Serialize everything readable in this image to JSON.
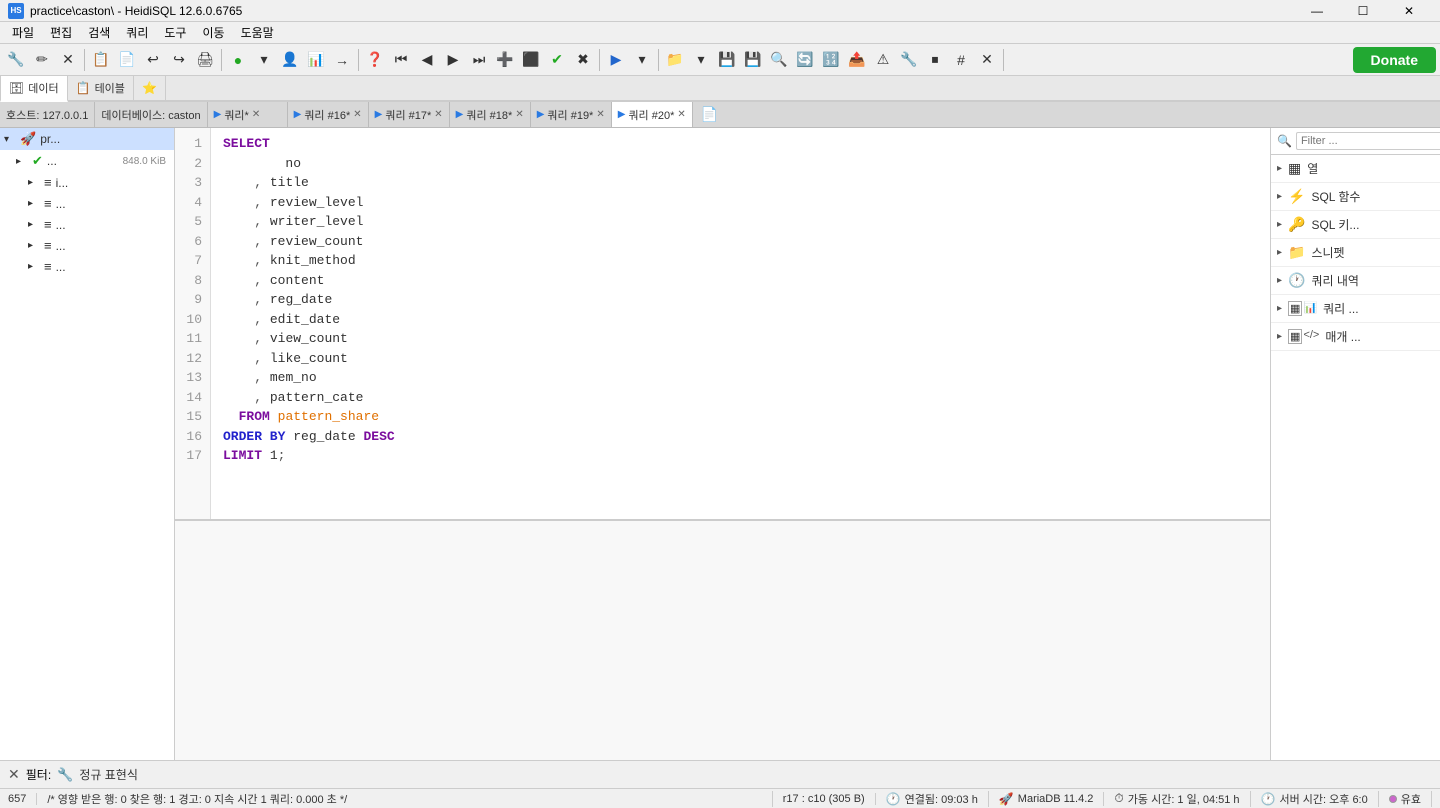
{
  "titlebar": {
    "icon": "HS",
    "title": "practice\\caston\\ - HeidiSQL 12.6.0.6765",
    "min": "—",
    "max": "☐",
    "close": "✕"
  },
  "menubar": {
    "items": [
      "파일",
      "편집",
      "검색",
      "쿼리",
      "도구",
      "이동",
      "도움말"
    ]
  },
  "toolbar": {
    "donate": "Donate"
  },
  "tabnav": {
    "items": [
      {
        "icon": "🗄",
        "label": "데이터",
        "active": true,
        "closable": false
      },
      {
        "icon": "📋",
        "label": "테이블",
        "active": false,
        "closable": false
      },
      {
        "icon": "⭐",
        "label": "",
        "active": false,
        "closable": false
      }
    ]
  },
  "querytabs": {
    "items": [
      {
        "label": "호스트: 127.0.0.1",
        "active": false,
        "closable": false,
        "hasPlay": false
      },
      {
        "label": "데이터베이스: caston",
        "active": false,
        "closable": false,
        "hasPlay": false
      },
      {
        "label": "쿼리*",
        "active": false,
        "closable": true,
        "hasPlay": false
      },
      {
        "label": "쿼리 #16*",
        "active": false,
        "closable": true,
        "hasPlay": false
      },
      {
        "label": "쿼리 #17*",
        "active": false,
        "closable": true,
        "hasPlay": false
      },
      {
        "label": "쿼리 #18*",
        "active": false,
        "closable": true,
        "hasPlay": false
      },
      {
        "label": "쿼리 #19*",
        "active": false,
        "closable": true,
        "hasPlay": false
      },
      {
        "label": "쿼리 #20*",
        "active": true,
        "closable": true,
        "hasPlay": true
      }
    ]
  },
  "sidebar": {
    "items": [
      {
        "level": 0,
        "arrow": "▾",
        "icon": "🚀",
        "label": "pr...",
        "badge": "",
        "selected": true
      },
      {
        "level": 0,
        "arrow": "▸",
        "icon": "✔",
        "label": "...",
        "badge": "848.0 KiB",
        "selected": false
      },
      {
        "level": 1,
        "arrow": "▸",
        "icon": "═",
        "label": "i...",
        "badge": "",
        "selected": false
      },
      {
        "level": 1,
        "arrow": "▸",
        "icon": "═",
        "label": "...",
        "badge": "",
        "selected": false
      },
      {
        "level": 1,
        "arrow": "▸",
        "icon": "═",
        "label": "...",
        "badge": "",
        "selected": false
      },
      {
        "level": 1,
        "arrow": "▸",
        "icon": "═",
        "label": "...",
        "badge": "",
        "selected": false
      },
      {
        "level": 1,
        "arrow": "▸",
        "icon": "═",
        "label": "...",
        "badge": "",
        "selected": false
      }
    ]
  },
  "editor": {
    "lines": [
      {
        "num": 1,
        "code": "SELECT"
      },
      {
        "num": 2,
        "code": "      no"
      },
      {
        "num": 3,
        "code": "    , title"
      },
      {
        "num": 4,
        "code": "    , review_level"
      },
      {
        "num": 5,
        "code": "    , writer_level"
      },
      {
        "num": 6,
        "code": "    , review_count"
      },
      {
        "num": 7,
        "code": "    , knit_method"
      },
      {
        "num": 8,
        "code": "    , content"
      },
      {
        "num": 9,
        "code": "    , reg_date"
      },
      {
        "num": 10,
        "code": "    , edit_date"
      },
      {
        "num": 11,
        "code": "    , view_count"
      },
      {
        "num": 12,
        "code": "    , like_count"
      },
      {
        "num": 13,
        "code": "    , mem_no"
      },
      {
        "num": 14,
        "code": "    , pattern_cate"
      },
      {
        "num": 15,
        "code": "  FROM pattern_share"
      },
      {
        "num": 16,
        "code": "ORDER BY reg_date DESC"
      },
      {
        "num": 17,
        "code": "LIMIT 1;"
      }
    ]
  },
  "rightpanel": {
    "filter_placeholder": "Filter ...",
    "items": [
      {
        "icon": "▦",
        "label": "열",
        "color": "#555"
      },
      {
        "icon": "⚡",
        "label": "SQL 함수",
        "color": "#e0c000"
      },
      {
        "icon": "🔑",
        "label": "SQL 키...",
        "color": "#e0a000"
      },
      {
        "icon": "📁",
        "label": "스니펫",
        "color": "#e0a000"
      },
      {
        "icon": "🕐",
        "label": "쿼리 내역",
        "color": "#555"
      },
      {
        "icon": "📊",
        "label": "쿼리 ...",
        "color": "#2244cc"
      },
      {
        "icon": "⟨/⟩",
        "label": "매개 ...",
        "color": "#555"
      }
    ]
  },
  "filterbar": {
    "close": "✕",
    "icon": "🔧",
    "label": "필터:",
    "filter_icon": "🔧",
    "filter_text": "정규 표현식"
  },
  "statusbar": {
    "row_count": "657",
    "comment": "/* 영향 받은 행: 0  찾은 행: 1  경고: 0  지속 시간 1 쿼리: 0.000 초 */",
    "position": "r17 : c10 (305 B)",
    "connection_icon": "🕐",
    "connection": "연결됨: 09:03 h",
    "db_icon": "🚀",
    "db": "MariaDB 11.4.2",
    "uptime_icon": "⏱",
    "uptime": "가동 시간: 1 일, 04:51 h",
    "server_icon": "🕐",
    "server": "서버 시간: 오후 6:0",
    "status": "유효"
  }
}
